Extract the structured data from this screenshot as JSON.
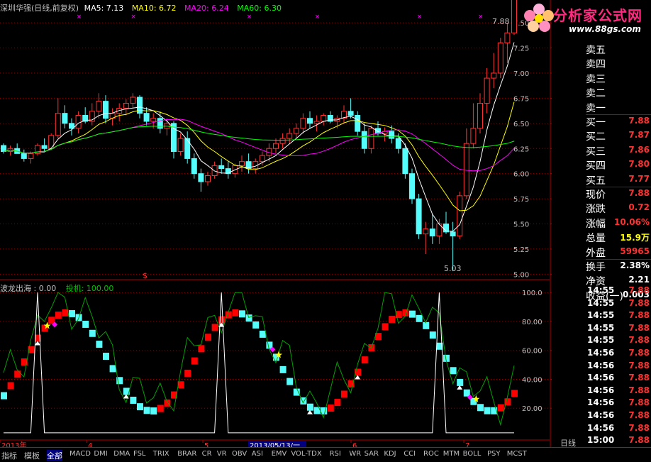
{
  "header": {
    "stock": "深圳华强(日线,前复权)",
    "ma5": "MA5: 7.13",
    "ma10": "MA10: 6.72",
    "ma20": "MA20: 6.24",
    "ma60": "MA60: 6.30",
    "high_label": "7.88",
    "low_label": "5.03"
  },
  "indicator": {
    "name": "波龙出海 : 0.00",
    "sub": "投机: 100.00",
    "marker": "$"
  },
  "logo": {
    "title": "分析家公式网",
    "url": "www.88gs.com"
  },
  "price_axis": [
    "7.50",
    "7.25",
    "7.00",
    "6.75",
    "6.50",
    "6.25",
    "6.00",
    "5.75",
    "5.50",
    "5.25",
    "5.00"
  ],
  "ind_axis": [
    "100.0",
    "80.00",
    "60.00",
    "40.00",
    "20.00"
  ],
  "x_axis": [
    "2013年",
    "4",
    "5",
    "2013/05/13/一",
    "6",
    "7"
  ],
  "quote": [
    {
      "label": "卖五",
      "value": "",
      "color": "#ff3232"
    },
    {
      "label": "卖四",
      "value": "",
      "color": "#ff3232"
    },
    {
      "label": "卖三",
      "value": "",
      "color": "#ff3232"
    },
    {
      "label": "卖二",
      "value": "",
      "color": "#ff3232"
    },
    {
      "label": "卖一",
      "value": "",
      "color": "#ff3232"
    },
    {
      "label": "买一",
      "value": "7.88",
      "color": "#ff3232"
    },
    {
      "label": "买二",
      "value": "7.87",
      "color": "#ff3232"
    },
    {
      "label": "买三",
      "value": "7.86",
      "color": "#ff3232"
    },
    {
      "label": "买四",
      "value": "7.80",
      "color": "#ff3232"
    },
    {
      "label": "买五",
      "value": "7.77",
      "color": "#ff3232"
    },
    {
      "label": "现价",
      "value": "7.88",
      "color": "#ff3232"
    },
    {
      "label": "涨跌",
      "value": "0.72",
      "color": "#ff3232"
    },
    {
      "label": "涨幅",
      "value": "10.06%",
      "color": "#ff3232"
    },
    {
      "label": "总量",
      "value": "15.9万",
      "color": "#ffff00"
    },
    {
      "label": "外盘",
      "value": "59965",
      "color": "#ff3232"
    },
    {
      "label": "换手",
      "value": "2.38%",
      "color": "#ffffff"
    },
    {
      "label": "净资",
      "value": "2.21",
      "color": "#ffffff"
    },
    {
      "label": "收益(一)",
      "value": "0.003",
      "color": "#ffffff"
    }
  ],
  "ticks": [
    {
      "time": "14:55",
      "price": "7.88"
    },
    {
      "time": "14:55",
      "price": "7.88"
    },
    {
      "time": "14:55",
      "price": "7.88"
    },
    {
      "time": "14:55",
      "price": "7.88"
    },
    {
      "time": "14:55",
      "price": "7.88"
    },
    {
      "time": "14:56",
      "price": "7.88"
    },
    {
      "time": "14:56",
      "price": "7.88"
    },
    {
      "time": "14:56",
      "price": "7.88"
    },
    {
      "time": "14:56",
      "price": "7.88"
    },
    {
      "time": "14:56",
      "price": "7.88"
    },
    {
      "time": "14:56",
      "price": "7.88"
    },
    {
      "time": "14:56",
      "price": "7.88"
    },
    {
      "time": "15:00",
      "price": "7.88"
    }
  ],
  "period": "日线",
  "bottom_tabs": [
    "指标",
    "模板",
    "全部",
    "MACD",
    "DMI",
    "DMA",
    "FSL",
    "TRIX",
    "BRAR",
    "CR",
    "VR",
    "OBV",
    "ASI",
    "EMV",
    "VOL-TDX",
    "RSI",
    "WR",
    "SAR",
    "KDJ",
    "CCI",
    "ROC",
    "MTM",
    "BOLL",
    "PSY",
    "MCST"
  ],
  "colors": {
    "up": "#ff3232",
    "down": "#54fcfc",
    "ma5": "#ffffff",
    "ma10": "#ffff00",
    "ma20": "#ff00ff",
    "ma60": "#00ff00",
    "grid": "#8b0000",
    "axis": "#b00000"
  },
  "chart_data": {
    "type": "candlestick",
    "ohlc": [
      [
        6.28,
        6.3,
        6.2,
        6.22
      ],
      [
        6.22,
        6.28,
        6.18,
        6.25
      ],
      [
        6.25,
        6.3,
        6.2,
        6.2
      ],
      [
        6.2,
        6.24,
        6.12,
        6.15
      ],
      [
        6.15,
        6.22,
        6.1,
        6.2
      ],
      [
        6.2,
        6.3,
        6.18,
        6.28
      ],
      [
        6.28,
        6.35,
        6.22,
        6.25
      ],
      [
        6.25,
        6.4,
        6.24,
        6.38
      ],
      [
        6.38,
        6.75,
        6.35,
        6.6
      ],
      [
        6.6,
        6.68,
        6.45,
        6.5
      ],
      [
        6.5,
        6.55,
        6.38,
        6.45
      ],
      [
        6.45,
        6.62,
        6.4,
        6.58
      ],
      [
        6.58,
        6.66,
        6.5,
        6.52
      ],
      [
        6.52,
        6.7,
        6.48,
        6.62
      ],
      [
        6.62,
        6.8,
        6.55,
        6.72
      ],
      [
        6.72,
        6.78,
        6.5,
        6.55
      ],
      [
        6.55,
        6.65,
        6.48,
        6.6
      ],
      [
        6.6,
        6.7,
        6.52,
        6.65
      ],
      [
        6.65,
        6.74,
        6.58,
        6.7
      ],
      [
        6.7,
        6.8,
        6.65,
        6.76
      ],
      [
        6.76,
        6.78,
        6.55,
        6.6
      ],
      [
        6.6,
        6.66,
        6.48,
        6.52
      ],
      [
        6.52,
        6.6,
        6.45,
        6.55
      ],
      [
        6.55,
        6.62,
        6.4,
        6.45
      ],
      [
        6.45,
        6.55,
        6.38,
        6.5
      ],
      [
        6.5,
        6.52,
        6.15,
        6.22
      ],
      [
        6.22,
        6.4,
        6.18,
        6.35
      ],
      [
        6.35,
        6.42,
        6.1,
        6.15
      ],
      [
        6.15,
        6.2,
        5.95,
        6.0
      ],
      [
        6.0,
        6.05,
        5.82,
        5.92
      ],
      [
        5.92,
        6.02,
        5.88,
        5.98
      ],
      [
        5.98,
        6.12,
        5.95,
        6.08
      ],
      [
        6.08,
        6.15,
        6.0,
        6.05
      ],
      [
        6.05,
        6.12,
        5.95,
        6.0
      ],
      [
        6.0,
        6.1,
        5.96,
        6.08
      ],
      [
        6.08,
        6.18,
        6.02,
        6.12
      ],
      [
        6.12,
        6.2,
        6.0,
        6.05
      ],
      [
        6.05,
        6.15,
        6.0,
        6.12
      ],
      [
        6.12,
        6.22,
        6.08,
        6.18
      ],
      [
        6.18,
        6.3,
        6.12,
        6.25
      ],
      [
        6.25,
        6.35,
        6.2,
        6.3
      ],
      [
        6.3,
        6.4,
        6.25,
        6.35
      ],
      [
        6.35,
        6.45,
        6.3,
        6.4
      ],
      [
        6.4,
        6.5,
        6.35,
        6.45
      ],
      [
        6.45,
        6.6,
        6.4,
        6.55
      ],
      [
        6.55,
        6.62,
        6.45,
        6.5
      ],
      [
        6.5,
        6.58,
        6.42,
        6.52
      ],
      [
        6.52,
        6.6,
        6.48,
        6.58
      ],
      [
        6.58,
        6.62,
        6.5,
        6.52
      ],
      [
        6.52,
        6.58,
        6.45,
        6.55
      ],
      [
        6.55,
        6.68,
        6.5,
        6.62
      ],
      [
        6.62,
        6.75,
        6.55,
        6.58
      ],
      [
        6.58,
        6.62,
        6.38,
        6.42
      ],
      [
        6.42,
        6.5,
        6.2,
        6.25
      ],
      [
        6.25,
        6.48,
        6.2,
        6.45
      ],
      [
        6.45,
        6.52,
        6.38,
        6.4
      ],
      [
        6.4,
        6.46,
        6.32,
        6.42
      ],
      [
        6.42,
        6.48,
        6.3,
        6.35
      ],
      [
        6.35,
        6.4,
        6.2,
        6.25
      ],
      [
        6.25,
        6.3,
        5.95,
        6.0
      ],
      [
        6.0,
        6.05,
        5.7,
        5.75
      ],
      [
        5.75,
        5.8,
        5.35,
        5.4
      ],
      [
        5.4,
        5.52,
        5.2,
        5.45
      ],
      [
        5.45,
        5.6,
        5.3,
        5.38
      ],
      [
        5.38,
        5.55,
        5.3,
        5.5
      ],
      [
        5.5,
        5.62,
        5.4,
        5.42
      ],
      [
        5.42,
        5.52,
        5.03,
        5.38
      ],
      [
        5.38,
        5.82,
        5.35,
        5.78
      ],
      [
        5.78,
        6.45,
        5.75,
        6.3
      ],
      [
        6.3,
        6.7,
        6.25,
        6.45
      ],
      [
        6.45,
        6.8,
        6.4,
        6.7
      ],
      [
        6.7,
        7.05,
        6.6,
        6.95
      ],
      [
        6.95,
        7.2,
        6.85,
        7.0
      ],
      [
        7.0,
        7.35,
        6.95,
        7.3
      ],
      [
        7.3,
        7.5,
        7.1,
        7.4
      ],
      [
        7.4,
        7.88,
        7.38,
        7.88
      ]
    ]
  }
}
